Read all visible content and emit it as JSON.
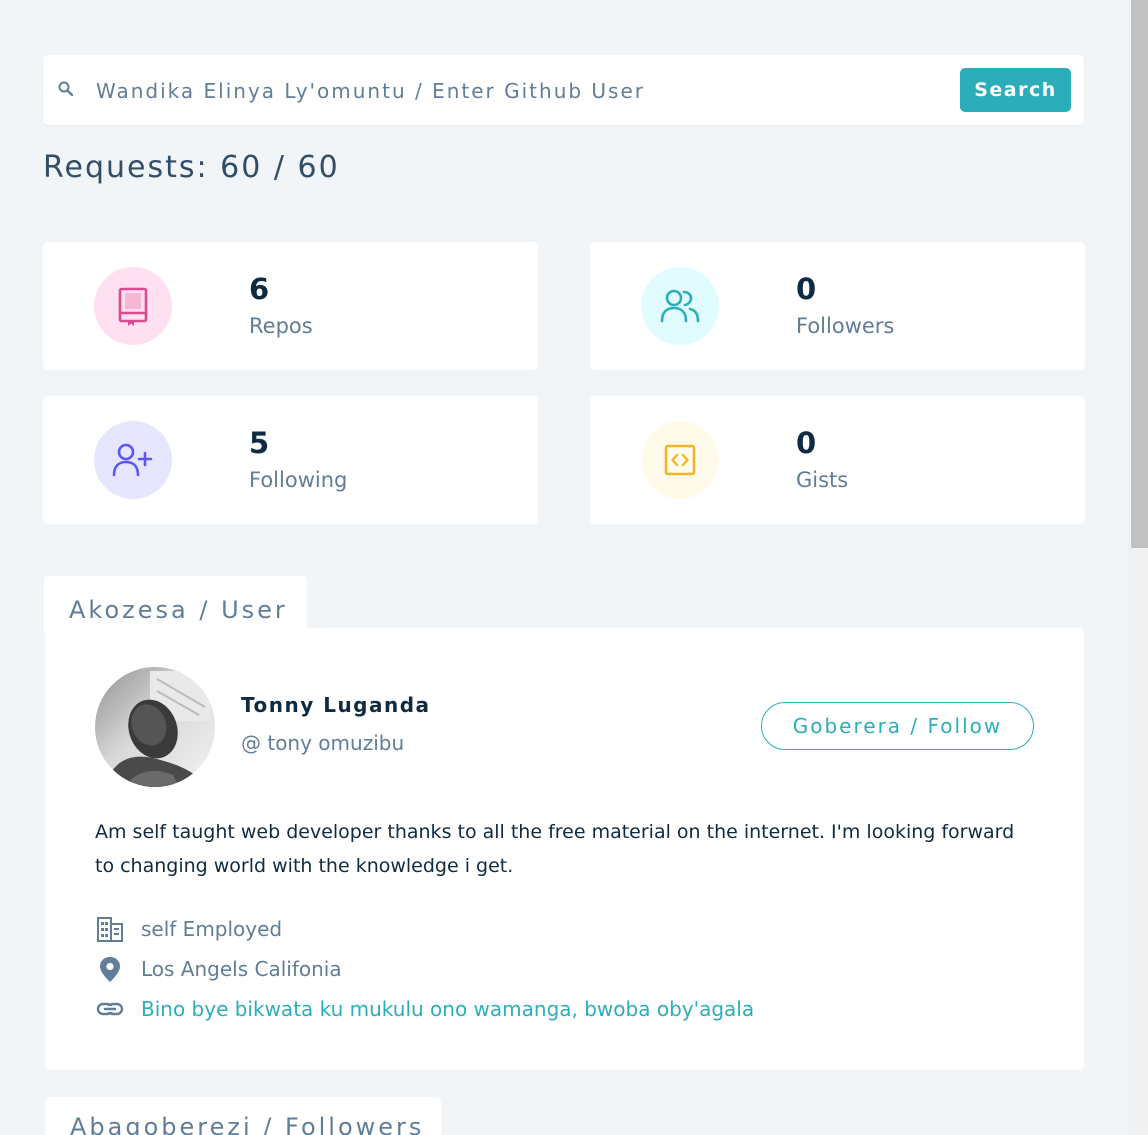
{
  "search": {
    "placeholder": "Wandika Elinya Ly'omuntu / Enter Github User",
    "value": "",
    "button_label": "Search"
  },
  "requests": {
    "label": "Requests: 60 / 60"
  },
  "stats": [
    {
      "value": "6",
      "label": "Repos",
      "icon": "book-icon",
      "color": "#da4a91",
      "bg": "#ffe0f0"
    },
    {
      "value": "0",
      "label": "Followers",
      "icon": "users-icon",
      "color": "#2caeba",
      "bg": "#e0fcff"
    },
    {
      "value": "5",
      "label": "Following",
      "icon": "user-plus-icon",
      "color": "#5d55fa",
      "bg": "#e6e6ff"
    },
    {
      "value": "0",
      "label": "Gists",
      "icon": "code-icon",
      "color": "#f0b429",
      "bg": "#fffbea"
    }
  ],
  "user_section": {
    "tab_label": "Akozesa / User",
    "name": "Tonny Luganda",
    "handle": "@ tony omuzibu",
    "follow_label": "Goberera / Follow",
    "bio": "Am self taught web developer thanks to all the free material on the internet. I'm looking forward to changing world with the knowledge i get.",
    "company": "self Employed",
    "location": "Los Angels Califonia",
    "blog": "Bino bye bikwata ku mukulu ono wamanga, bwoba oby'agala"
  },
  "followers_section": {
    "tab_label": "Abagoberezi / Followers"
  },
  "colors": {
    "accent": "#2caeba",
    "background": "#f1f5f8"
  }
}
